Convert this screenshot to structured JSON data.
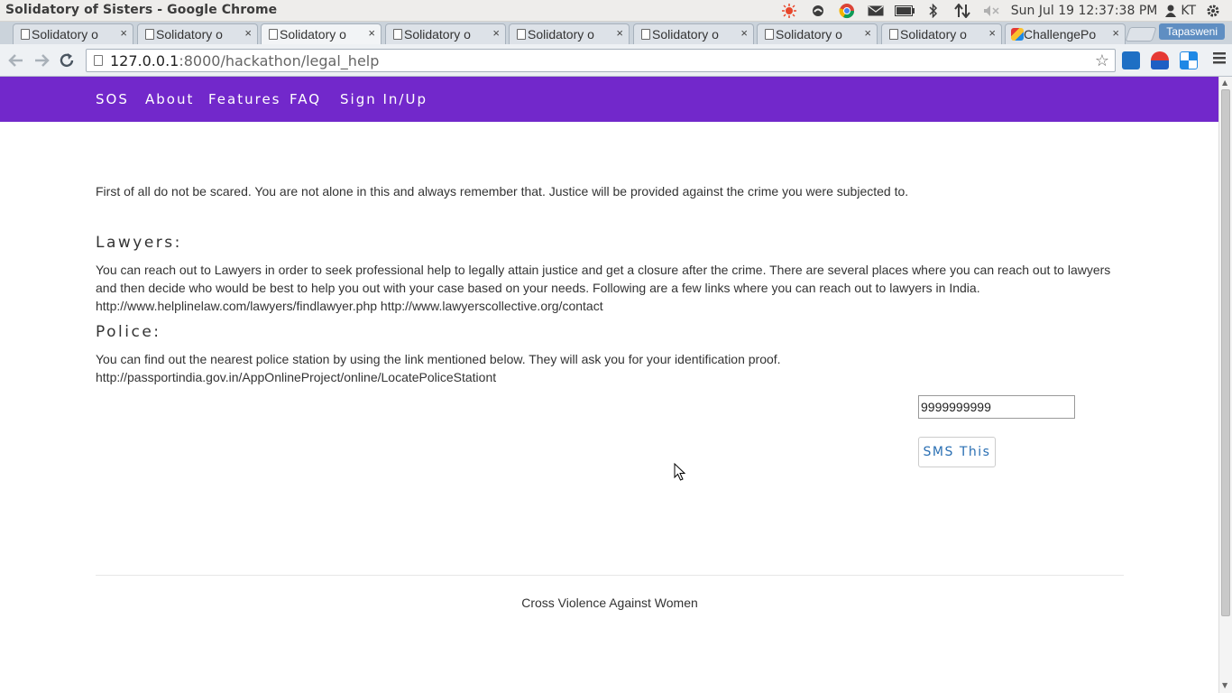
{
  "os": {
    "window_title": "Solidatory of Sisters - Google Chrome",
    "clock": "Sun Jul 19 12:37:38 PM",
    "user": "KT"
  },
  "tabs": [
    {
      "label": "Solidatory o",
      "active": false
    },
    {
      "label": "Solidatory o",
      "active": false
    },
    {
      "label": "Solidatory o",
      "active": true
    },
    {
      "label": "Solidatory o",
      "active": false
    },
    {
      "label": "Solidatory o",
      "active": false
    },
    {
      "label": "Solidatory o",
      "active": false
    },
    {
      "label": "Solidatory o",
      "active": false
    },
    {
      "label": "Solidatory o",
      "active": false
    },
    {
      "label": "ChallengePo",
      "active": false
    }
  ],
  "profile_name": "Tapasweni",
  "address_bar": {
    "host": "127.0.0.1",
    "rest": ":8000/hackathon/legal_help"
  },
  "site_nav": [
    "SOS",
    "About",
    "Features",
    "FAQ",
    "Sign In/Up"
  ],
  "page": {
    "intro": "First of all do not be scared. You are not alone in this and always remember that. Justice will be provided against the crime you were subjected to.",
    "lawyers_heading": "Lawyers:",
    "lawyers_text": "You can reach out to Lawyers in order to seek professional help to legally attain justice and get a closure after the crime. There are several places where you can reach out to lawyers and then decide who would be best to help you out with your case based on your needs. Following are a few links where you can reach out to lawyers in India.",
    "lawyers_links": "http://www.helplinelaw.com/lawyers/findlawyer.php http://www.lawyerscollective.org/contact",
    "police_heading": "Police:",
    "police_text": "You can find out the nearest police station by using the link mentioned below. They will ask you for your identification proof.",
    "police_link": "http://passportindia.gov.in/AppOnlineProject/online/LocatePoliceStationt",
    "phone_value": "9999999999",
    "sms_button": "SMS This",
    "footer": "Cross Violence Against Women"
  },
  "colors": {
    "nav_bg": "#7228cb",
    "sms_text": "#2a6fb3"
  }
}
